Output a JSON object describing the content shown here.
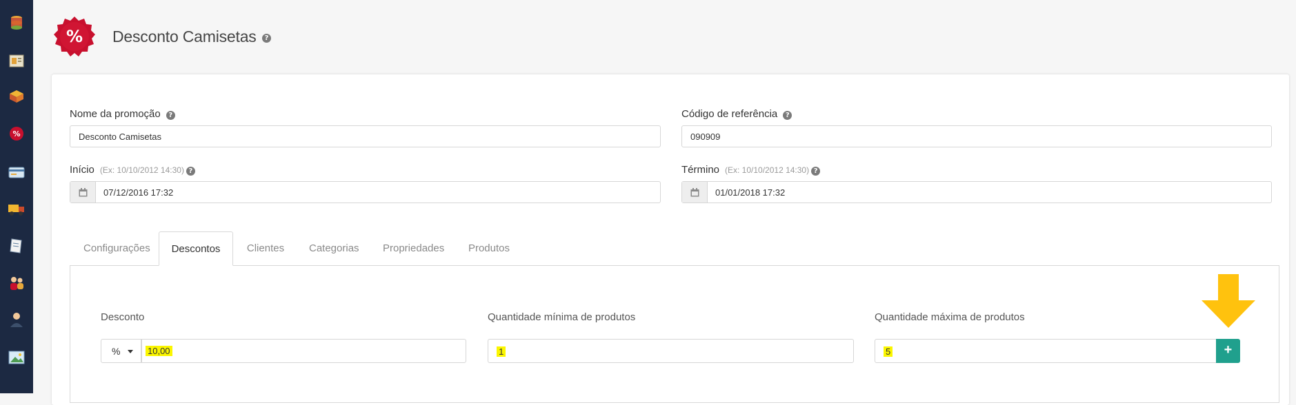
{
  "header": {
    "title": "Desconto Camisetas",
    "help": "?"
  },
  "form": {
    "promo_name": {
      "label": "Nome da promoção",
      "value": "Desconto Camisetas"
    },
    "ref_code": {
      "label": "Código de referência",
      "value": "090909"
    },
    "start": {
      "label": "Início",
      "hint": "(Ex: 10/10/2012 14:30)",
      "value": "07/12/2016 17:32"
    },
    "end": {
      "label": "Término",
      "hint": "(Ex: 10/10/2012 14:30)",
      "value": "01/01/2018 17:32"
    }
  },
  "tabs": [
    {
      "label": "Configurações"
    },
    {
      "label": "Descontos"
    },
    {
      "label": "Clientes"
    },
    {
      "label": "Categorias"
    },
    {
      "label": "Propriedades"
    },
    {
      "label": "Produtos"
    }
  ],
  "active_tab": "Descontos",
  "discounts": {
    "discount": {
      "label": "Desconto",
      "type": "%",
      "value": "10,00"
    },
    "min_qty": {
      "label": "Quantidade mínima de produtos",
      "value": "1"
    },
    "max_qty": {
      "label": "Quantidade máxima de produtos",
      "value": "5"
    },
    "add_label": "+"
  },
  "colors": {
    "sidebar": "#1c2942",
    "accent_red": "#c8102e",
    "add_button": "#20a08d",
    "highlight": "#fbf600",
    "arrow": "#ffc20e"
  },
  "sidebar_icons": [
    "database-icon",
    "catalog-icon",
    "boxes-icon",
    "discount-icon",
    "payment-card-icon",
    "delivery-truck-icon",
    "document-icon",
    "users-icon",
    "profile-icon",
    "picture-icon"
  ]
}
